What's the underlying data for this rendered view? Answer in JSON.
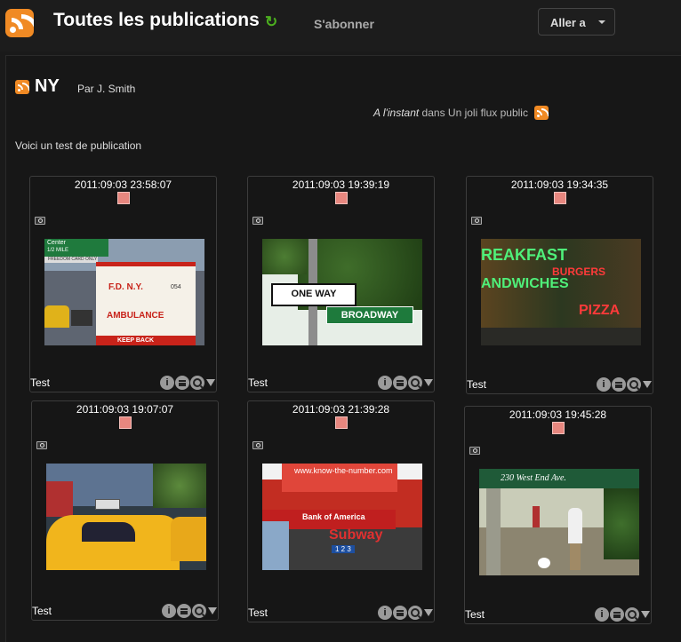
{
  "header": {
    "title": "Toutes les publications",
    "subscribe_label": "S'abonner",
    "goto_label": "Aller a",
    "refresh_icon": "refresh-icon",
    "logo_icon": "rss-icon"
  },
  "publication": {
    "title": "NY",
    "author": "Par J. Smith",
    "time": "A l'instant",
    "in_text": " dans ",
    "feed_name": "Un joli flux public",
    "body": "Voici un test de publication"
  },
  "photos": [
    {
      "timestamp": "2011:09:03 23:58:07",
      "label": "Test"
    },
    {
      "timestamp": "2011:09:03 19:39:19",
      "label": "Test"
    },
    {
      "timestamp": "2011:09:03 19:34:35",
      "label": "Test"
    },
    {
      "timestamp": "2011:09:03 19:07:07",
      "label": "Test"
    },
    {
      "timestamp": "2011:09:03 21:39:28",
      "label": "Test"
    },
    {
      "timestamp": "2011:09:03 19:45:28",
      "label": "Test"
    }
  ],
  "photo_text": {
    "p1_sign_top": "Center",
    "p1_sign_bottom": "1/2 MILE",
    "p1_plate": "FREEDOM CARD ONLY",
    "p1_fdny": "F.D.   N.Y.",
    "p1_number": "054",
    "p1_ambulance": "AMBULANCE",
    "p1_keepback": "KEEP BACK",
    "p2_oneway": "ONE WAY",
    "p2_broadway": "BROADWAY",
    "p3_breakfast": "REAKFAST",
    "p3_sandwiches": "ANDWICHES",
    "p3_burgers": "BURGERS",
    "p3_pizza": "PIZZA",
    "p5_url": "www.know-the-number.com",
    "p5_bank": "Bank of America",
    "p5_subway": "Subway",
    "p5_trains": "1 2 3",
    "p6_awning": "230 West End Ave."
  },
  "colors": {
    "background": "#1a1a1a",
    "rss_orange": "#f08a24",
    "refresh_green": "#4caf1f",
    "marker": "#e7877f"
  }
}
